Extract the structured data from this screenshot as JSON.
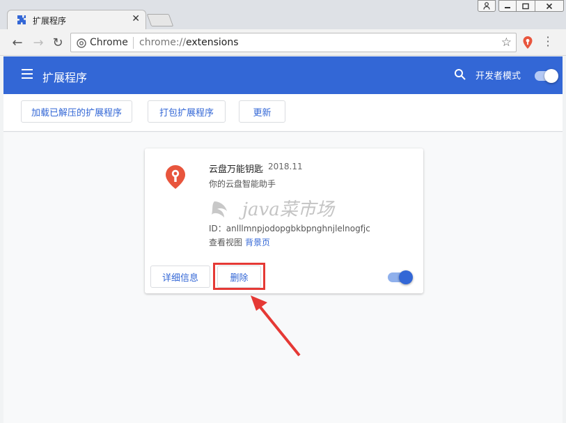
{
  "browser": {
    "tab_title": "扩展程序",
    "site_name": "Chrome",
    "url_scheme": "chrome://",
    "url_path": "extensions"
  },
  "header": {
    "title": "扩展程序",
    "developer_mode_label": "开发者模式",
    "developer_mode_on": true
  },
  "actions": {
    "load_unpacked": "加载已解压的扩展程序",
    "pack_extension": "打包扩展程序",
    "update": "更新"
  },
  "extension": {
    "name": "云盘万能钥匙",
    "version": "2018.11",
    "description": "你的云盘智能助手",
    "id": "ID：anlllmnpjodopgbkbpnghnjlelnogfjc",
    "views_label": "查看视图",
    "views_link": "背景页",
    "details_label": "详细信息",
    "remove_label": "删除",
    "enabled": true
  },
  "watermark": {
    "text": "java菜市场"
  },
  "colors": {
    "accent": "#3367d6",
    "highlight": "#e53935",
    "extension_logo": "#e8553d"
  }
}
